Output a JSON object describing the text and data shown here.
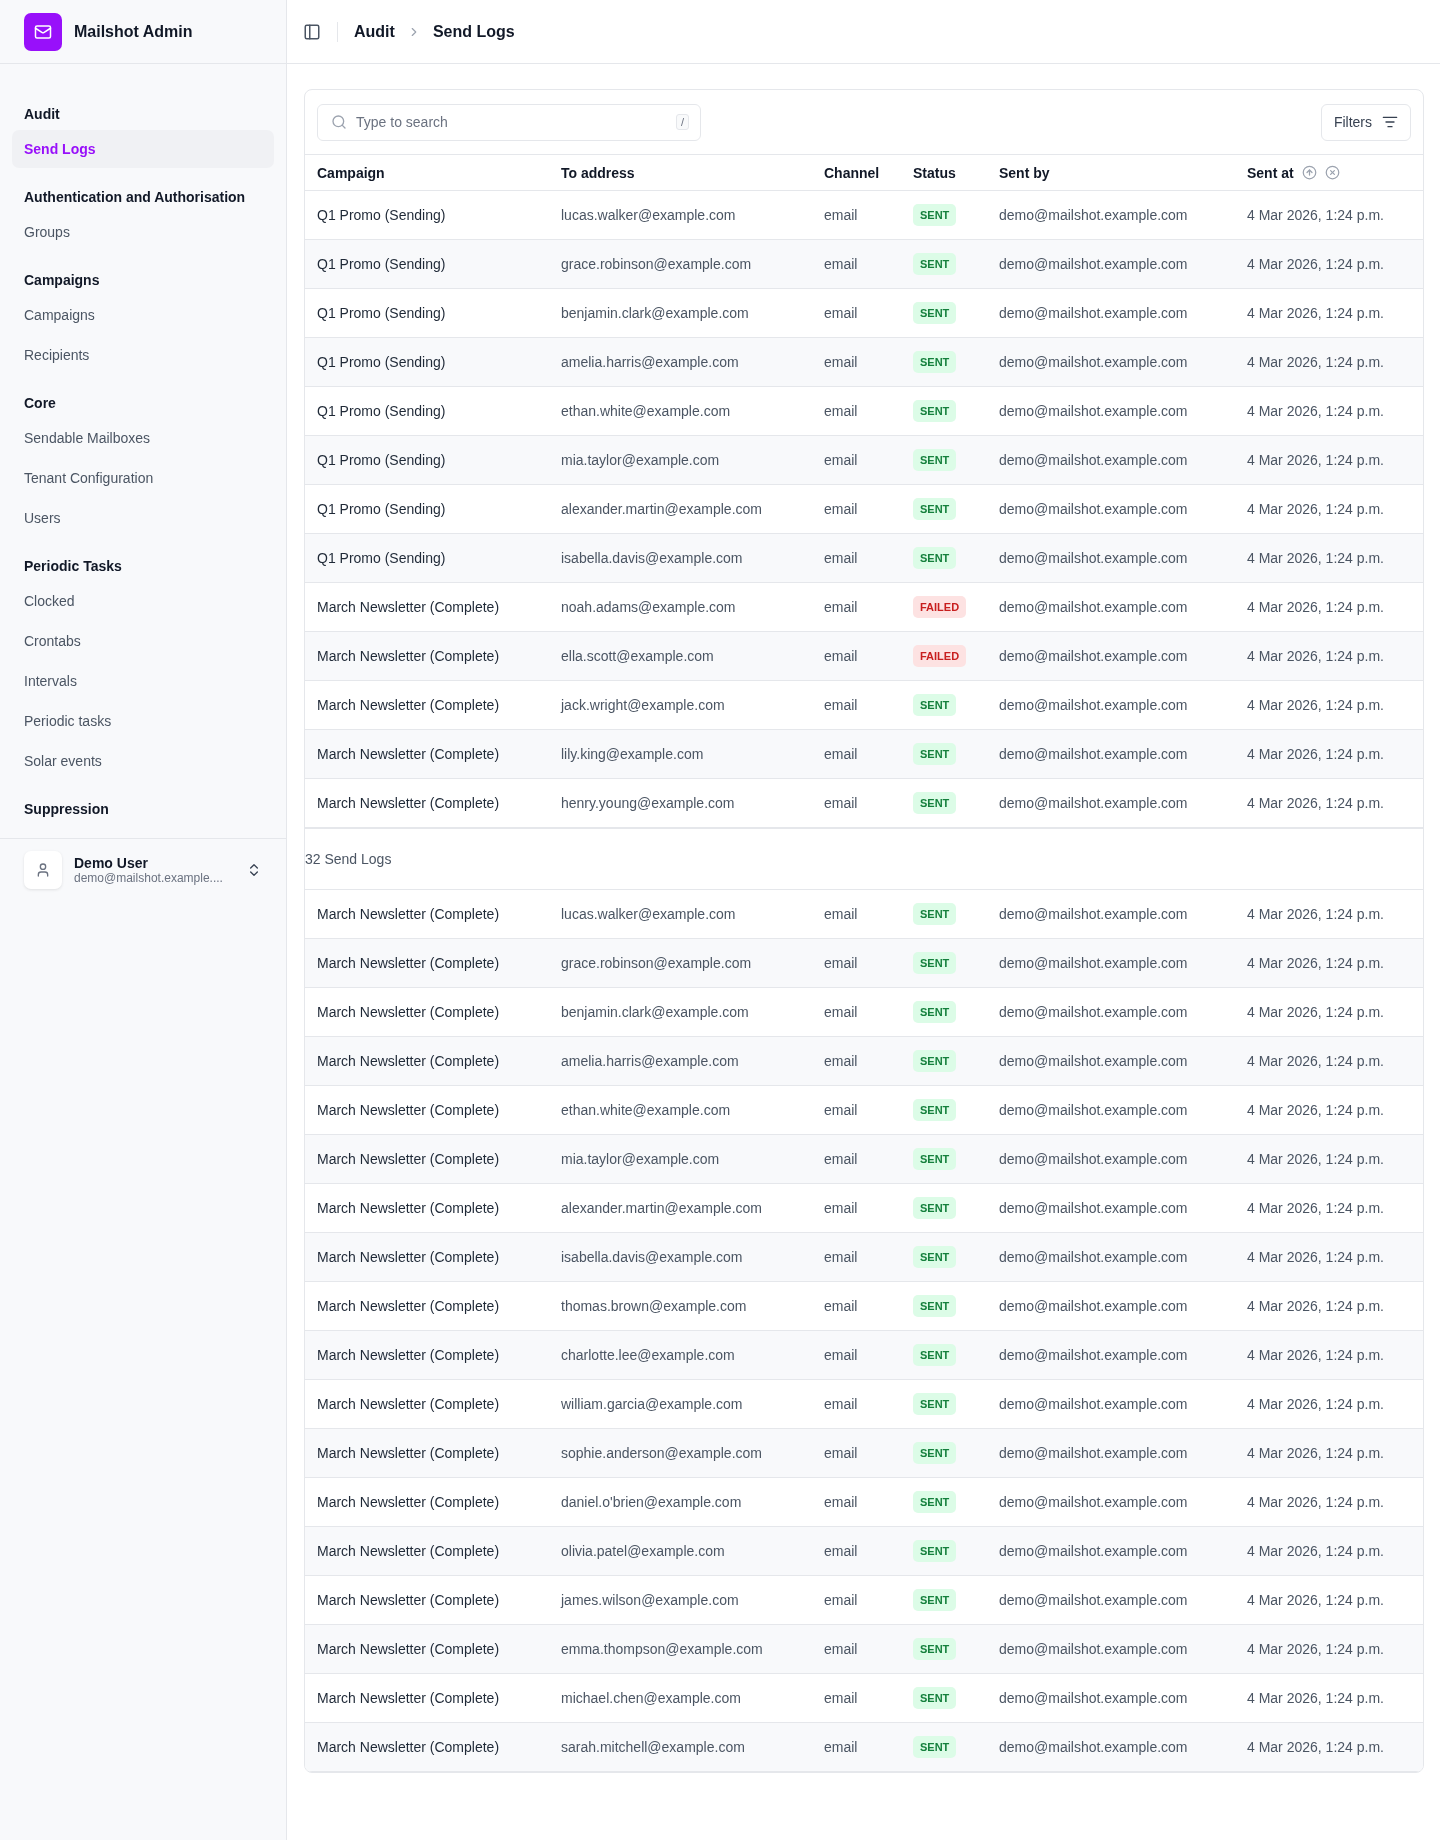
{
  "brand": {
    "title": "Mailshot Admin"
  },
  "breadcrumb": [
    "Audit",
    "Send Logs"
  ],
  "sidebar": {
    "groups": [
      {
        "title": "Audit",
        "items": [
          {
            "label": "Send Logs",
            "selected": true
          }
        ]
      },
      {
        "title": "Authentication and Authorisation",
        "items": [
          {
            "label": "Groups",
            "selected": false
          }
        ]
      },
      {
        "title": "Campaigns",
        "items": [
          {
            "label": "Campaigns",
            "selected": false
          },
          {
            "label": "Recipients",
            "selected": false
          }
        ]
      },
      {
        "title": "Core",
        "items": [
          {
            "label": "Sendable Mailboxes",
            "selected": false
          },
          {
            "label": "Tenant Configuration",
            "selected": false
          },
          {
            "label": "Users",
            "selected": false
          }
        ]
      },
      {
        "title": "Periodic Tasks",
        "items": [
          {
            "label": "Clocked",
            "selected": false
          },
          {
            "label": "Crontabs",
            "selected": false
          },
          {
            "label": "Intervals",
            "selected": false
          },
          {
            "label": "Periodic tasks",
            "selected": false
          },
          {
            "label": "Solar events",
            "selected": false
          }
        ]
      },
      {
        "title": "Suppression"
      }
    ],
    "user": {
      "name": "Demo User",
      "email": "demo@mailshot.example...."
    }
  },
  "search": {
    "placeholder": "Type to search",
    "shortcut": "/"
  },
  "filters_button": "Filters",
  "table": {
    "columns": [
      "Campaign",
      "To address",
      "Channel",
      "Status",
      "Sent by",
      "Sent at"
    ],
    "rows": [
      {
        "campaign": "Q1 Promo (Sending)",
        "to": "lucas.walker@example.com",
        "channel": "email",
        "status": {
          "kind": "sent",
          "label": "SENT"
        },
        "sent_by": "demo@mailshot.example.com",
        "sent_at": "4 Mar 2026, 1:24 p.m."
      },
      {
        "campaign": "Q1 Promo (Sending)",
        "to": "grace.robinson@example.com",
        "channel": "email",
        "status": {
          "kind": "sent",
          "label": "SENT"
        },
        "sent_by": "demo@mailshot.example.com",
        "sent_at": "4 Mar 2026, 1:24 p.m."
      },
      {
        "campaign": "Q1 Promo (Sending)",
        "to": "benjamin.clark@example.com",
        "channel": "email",
        "status": {
          "kind": "sent",
          "label": "SENT"
        },
        "sent_by": "demo@mailshot.example.com",
        "sent_at": "4 Mar 2026, 1:24 p.m."
      },
      {
        "campaign": "Q1 Promo (Sending)",
        "to": "amelia.harris@example.com",
        "channel": "email",
        "status": {
          "kind": "sent",
          "label": "SENT"
        },
        "sent_by": "demo@mailshot.example.com",
        "sent_at": "4 Mar 2026, 1:24 p.m."
      },
      {
        "campaign": "Q1 Promo (Sending)",
        "to": "ethan.white@example.com",
        "channel": "email",
        "status": {
          "kind": "sent",
          "label": "SENT"
        },
        "sent_by": "demo@mailshot.example.com",
        "sent_at": "4 Mar 2026, 1:24 p.m."
      },
      {
        "campaign": "Q1 Promo (Sending)",
        "to": "mia.taylor@example.com",
        "channel": "email",
        "status": {
          "kind": "sent",
          "label": "SENT"
        },
        "sent_by": "demo@mailshot.example.com",
        "sent_at": "4 Mar 2026, 1:24 p.m."
      },
      {
        "campaign": "Q1 Promo (Sending)",
        "to": "alexander.martin@example.com",
        "channel": "email",
        "status": {
          "kind": "sent",
          "label": "SENT"
        },
        "sent_by": "demo@mailshot.example.com",
        "sent_at": "4 Mar 2026, 1:24 p.m."
      },
      {
        "campaign": "Q1 Promo (Sending)",
        "to": "isabella.davis@example.com",
        "channel": "email",
        "status": {
          "kind": "sent",
          "label": "SENT"
        },
        "sent_by": "demo@mailshot.example.com",
        "sent_at": "4 Mar 2026, 1:24 p.m."
      },
      {
        "campaign": "March Newsletter (Complete)",
        "to": "noah.adams@example.com",
        "channel": "email",
        "status": {
          "kind": "failed",
          "label": "FAILED"
        },
        "sent_by": "demo@mailshot.example.com",
        "sent_at": "4 Mar 2026, 1:24 p.m."
      },
      {
        "campaign": "March Newsletter (Complete)",
        "to": "ella.scott@example.com",
        "channel": "email",
        "status": {
          "kind": "failed",
          "label": "FAILED"
        },
        "sent_by": "demo@mailshot.example.com",
        "sent_at": "4 Mar 2026, 1:24 p.m."
      },
      {
        "campaign": "March Newsletter (Complete)",
        "to": "jack.wright@example.com",
        "channel": "email",
        "status": {
          "kind": "sent",
          "label": "SENT"
        },
        "sent_by": "demo@mailshot.example.com",
        "sent_at": "4 Mar 2026, 1:24 p.m."
      },
      {
        "campaign": "March Newsletter (Complete)",
        "to": "lily.king@example.com",
        "channel": "email",
        "status": {
          "kind": "sent",
          "label": "SENT"
        },
        "sent_by": "demo@mailshot.example.com",
        "sent_at": "4 Mar 2026, 1:24 p.m."
      },
      {
        "campaign": "March Newsletter (Complete)",
        "to": "henry.young@example.com",
        "channel": "email",
        "status": {
          "kind": "sent",
          "label": "SENT"
        },
        "sent_by": "demo@mailshot.example.com",
        "sent_at": "4 Mar 2026, 1:24 p.m."
      },
      {
        "campaign": "March Newsletter (Complete)",
        "to": "lucas.walker@example.com",
        "channel": "email",
        "status": {
          "kind": "sent",
          "label": "SENT"
        },
        "sent_by": "demo@mailshot.example.com",
        "sent_at": "4 Mar 2026, 1:24 p.m."
      },
      {
        "campaign": "March Newsletter (Complete)",
        "to": "grace.robinson@example.com",
        "channel": "email",
        "status": {
          "kind": "sent",
          "label": "SENT"
        },
        "sent_by": "demo@mailshot.example.com",
        "sent_at": "4 Mar 2026, 1:24 p.m."
      },
      {
        "campaign": "March Newsletter (Complete)",
        "to": "benjamin.clark@example.com",
        "channel": "email",
        "status": {
          "kind": "sent",
          "label": "SENT"
        },
        "sent_by": "demo@mailshot.example.com",
        "sent_at": "4 Mar 2026, 1:24 p.m."
      },
      {
        "campaign": "March Newsletter (Complete)",
        "to": "amelia.harris@example.com",
        "channel": "email",
        "status": {
          "kind": "sent",
          "label": "SENT"
        },
        "sent_by": "demo@mailshot.example.com",
        "sent_at": "4 Mar 2026, 1:24 p.m."
      },
      {
        "campaign": "March Newsletter (Complete)",
        "to": "ethan.white@example.com",
        "channel": "email",
        "status": {
          "kind": "sent",
          "label": "SENT"
        },
        "sent_by": "demo@mailshot.example.com",
        "sent_at": "4 Mar 2026, 1:24 p.m."
      },
      {
        "campaign": "March Newsletter (Complete)",
        "to": "mia.taylor@example.com",
        "channel": "email",
        "status": {
          "kind": "sent",
          "label": "SENT"
        },
        "sent_by": "demo@mailshot.example.com",
        "sent_at": "4 Mar 2026, 1:24 p.m."
      },
      {
        "campaign": "March Newsletter (Complete)",
        "to": "alexander.martin@example.com",
        "channel": "email",
        "status": {
          "kind": "sent",
          "label": "SENT"
        },
        "sent_by": "demo@mailshot.example.com",
        "sent_at": "4 Mar 2026, 1:24 p.m."
      },
      {
        "campaign": "March Newsletter (Complete)",
        "to": "isabella.davis@example.com",
        "channel": "email",
        "status": {
          "kind": "sent",
          "label": "SENT"
        },
        "sent_by": "demo@mailshot.example.com",
        "sent_at": "4 Mar 2026, 1:24 p.m."
      },
      {
        "campaign": "March Newsletter (Complete)",
        "to": "thomas.brown@example.com",
        "channel": "email",
        "status": {
          "kind": "sent",
          "label": "SENT"
        },
        "sent_by": "demo@mailshot.example.com",
        "sent_at": "4 Mar 2026, 1:24 p.m."
      },
      {
        "campaign": "March Newsletter (Complete)",
        "to": "charlotte.lee@example.com",
        "channel": "email",
        "status": {
          "kind": "sent",
          "label": "SENT"
        },
        "sent_by": "demo@mailshot.example.com",
        "sent_at": "4 Mar 2026, 1:24 p.m."
      },
      {
        "campaign": "March Newsletter (Complete)",
        "to": "william.garcia@example.com",
        "channel": "email",
        "status": {
          "kind": "sent",
          "label": "SENT"
        },
        "sent_by": "demo@mailshot.example.com",
        "sent_at": "4 Mar 2026, 1:24 p.m."
      },
      {
        "campaign": "March Newsletter (Complete)",
        "to": "sophie.anderson@example.com",
        "channel": "email",
        "status": {
          "kind": "sent",
          "label": "SENT"
        },
        "sent_by": "demo@mailshot.example.com",
        "sent_at": "4 Mar 2026, 1:24 p.m."
      },
      {
        "campaign": "March Newsletter (Complete)",
        "to": "daniel.o'brien@example.com",
        "channel": "email",
        "status": {
          "kind": "sent",
          "label": "SENT"
        },
        "sent_by": "demo@mailshot.example.com",
        "sent_at": "4 Mar 2026, 1:24 p.m."
      },
      {
        "campaign": "March Newsletter (Complete)",
        "to": "olivia.patel@example.com",
        "channel": "email",
        "status": {
          "kind": "sent",
          "label": "SENT"
        },
        "sent_by": "demo@mailshot.example.com",
        "sent_at": "4 Mar 2026, 1:24 p.m."
      },
      {
        "campaign": "March Newsletter (Complete)",
        "to": "james.wilson@example.com",
        "channel": "email",
        "status": {
          "kind": "sent",
          "label": "SENT"
        },
        "sent_by": "demo@mailshot.example.com",
        "sent_at": "4 Mar 2026, 1:24 p.m."
      },
      {
        "campaign": "March Newsletter (Complete)",
        "to": "emma.thompson@example.com",
        "channel": "email",
        "status": {
          "kind": "sent",
          "label": "SENT"
        },
        "sent_by": "demo@mailshot.example.com",
        "sent_at": "4 Mar 2026, 1:24 p.m."
      },
      {
        "campaign": "March Newsletter (Complete)",
        "to": "michael.chen@example.com",
        "channel": "email",
        "status": {
          "kind": "sent",
          "label": "SENT"
        },
        "sent_by": "demo@mailshot.example.com",
        "sent_at": "4 Mar 2026, 1:24 p.m."
      },
      {
        "campaign": "March Newsletter (Complete)",
        "to": "sarah.mitchell@example.com",
        "channel": "email",
        "status": {
          "kind": "sent",
          "label": "SENT"
        },
        "sent_by": "demo@mailshot.example.com",
        "sent_at": "4 Mar 2026, 1:24 p.m."
      }
    ]
  },
  "status_bar": {
    "text": "32 Send Logs"
  }
}
